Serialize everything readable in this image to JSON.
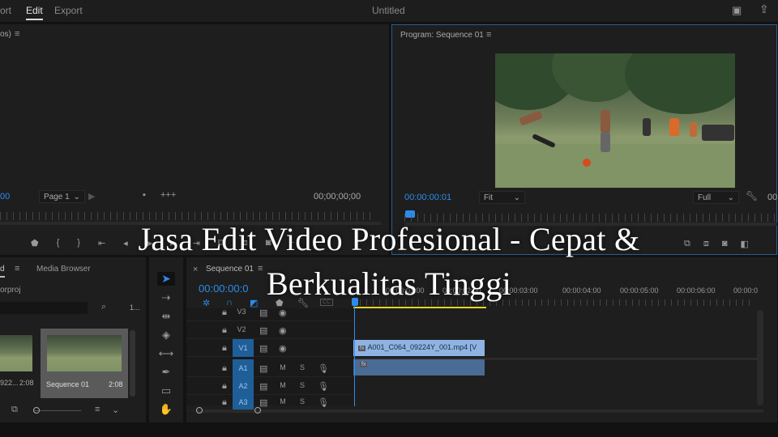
{
  "topbar": {
    "tabs": [
      "ort",
      "Edit",
      "Export"
    ],
    "active_tab": "Edit",
    "title": "Untitled"
  },
  "source": {
    "header": "os)",
    "timecode_left": "00",
    "page_select": "Page 1",
    "timecode_right": "00;00;00;00"
  },
  "program": {
    "header": "Program: Sequence 01",
    "timecode": "00:00:00:01",
    "zoom_select": "Fit",
    "quality_select": "Full",
    "timecode_right": "00:"
  },
  "project": {
    "tab_active": "d",
    "tab_media": "Media Browser",
    "project_name": "orproj",
    "count": "1...",
    "items": [
      {
        "name": "922...",
        "duration": "2:08"
      },
      {
        "name": "Sequence 01",
        "duration": "2:08"
      }
    ]
  },
  "timeline": {
    "tab": "Sequence 01",
    "timecode": "00:00:00:0",
    "ruler": [
      "00:00:01:00",
      "00:00:02:00",
      "00:00:03:00",
      "00:00:04:00",
      "00:00:05:00",
      "00:00:06:00",
      "00:00:0"
    ],
    "video_tracks": [
      "V3",
      "V2",
      "V1"
    ],
    "audio_tracks": [
      "A1",
      "A2",
      "A3"
    ],
    "mute": "M",
    "solo": "S",
    "clip_name": "A001_C064_09224Y_001.mp4 [V",
    "cc": "CC"
  },
  "overlay": {
    "line1": "Jasa Edit Video Profesional - Cepat &",
    "line2": "Berkualitas Tinggi"
  },
  "colors": {
    "accent": "#2d8ceb",
    "clip_video": "#8fb4e3",
    "clip_audio": "#4a6b94",
    "work_area": "#e4d32a"
  }
}
